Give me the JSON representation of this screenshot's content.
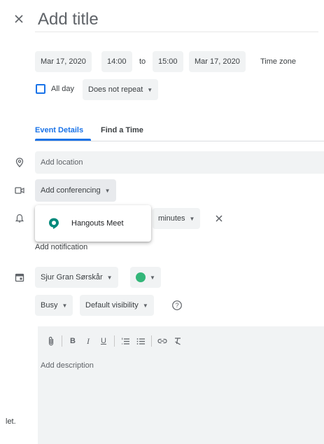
{
  "header": {
    "title_placeholder": "Add title"
  },
  "datetime": {
    "start_date": "Mar 17, 2020",
    "start_time": "14:00",
    "separator": "to",
    "end_time": "15:00",
    "end_date": "Mar 17, 2020",
    "timezone_label": "Time zone",
    "all_day_label": "All day",
    "all_day_checked": false,
    "repeat_value": "Does not repeat"
  },
  "tabs": [
    {
      "label": "Event Details",
      "active": true
    },
    {
      "label": "Find a Time",
      "active": false
    }
  ],
  "location": {
    "placeholder": "Add location"
  },
  "conferencing": {
    "label": "Add conferencing",
    "options": [
      {
        "label": "Hangouts Meet"
      }
    ]
  },
  "notification": {
    "unit_value": "minutes",
    "add_label": "Add notification"
  },
  "calendar": {
    "owner": "Sjur Gran Sørskår",
    "color": "#33b679"
  },
  "availability": {
    "status": "Busy",
    "visibility": "Default visibility"
  },
  "description": {
    "placeholder": "Add description",
    "toolbar": [
      "attach-icon",
      "bold-icon",
      "italic-icon",
      "underline-icon",
      "numbered-list-icon",
      "bulleted-list-icon",
      "link-icon",
      "clear-format-icon"
    ]
  },
  "side": {
    "truncated_text": "let."
  },
  "colors": {
    "accent": "#1a73e8",
    "chip_bg": "#f1f3f4",
    "meet_green": "#00897b"
  }
}
